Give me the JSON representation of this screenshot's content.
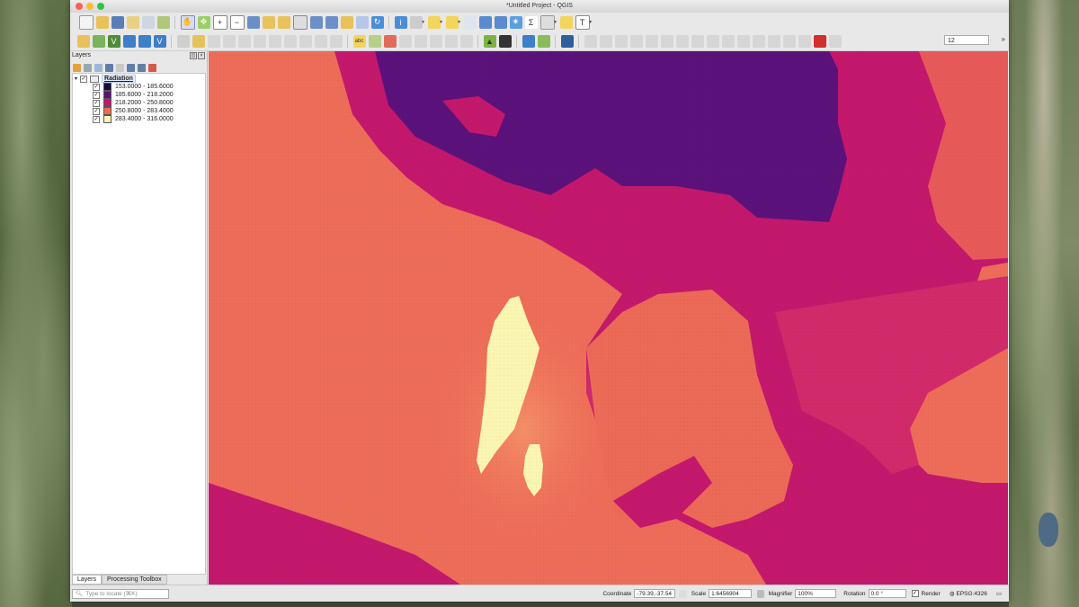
{
  "window": {
    "title": "*Untitled Project - QGIS"
  },
  "toolbar": {
    "zoom_value": "12",
    "more_glyph": "»"
  },
  "layers_panel": {
    "title": "Layers",
    "layer": {
      "name": "Radiation",
      "checked": true,
      "classes": [
        {
          "label": "153.0000 - 185.6000",
          "color": "#160b39"
        },
        {
          "label": "185.6000 - 218.2000",
          "color": "#5a117a"
        },
        {
          "label": "218.2000 - 250.8000",
          "color": "#c2176d"
        },
        {
          "label": "250.8000 - 283.4000",
          "color": "#f06a52"
        },
        {
          "label": "283.4000 - 316.0000",
          "color": "#fcf6b3"
        }
      ]
    },
    "tabs": [
      "Layers",
      "Processing Toolbox"
    ]
  },
  "locator": {
    "placeholder": "Type to locate (⌘K)"
  },
  "statusbar": {
    "coordinate_label": "Coordinate",
    "coordinate_value": "-79.39,-37.54",
    "scale_label": "Scale",
    "scale_value": "1:6456904",
    "magnifier_label": "Magnifier",
    "magnifier_value": "100%",
    "rotation_label": "Rotation",
    "rotation_value": "0.0 °",
    "render_label": "Render",
    "render_checked": true,
    "crs": "EPSG:4326"
  },
  "colors": {
    "map_background": "#ec6b5a",
    "class_1": "#160b39",
    "class_2": "#5a117a",
    "class_3": "#c2176d",
    "class_4": "#f06a52",
    "class_5": "#fcf6b3"
  }
}
